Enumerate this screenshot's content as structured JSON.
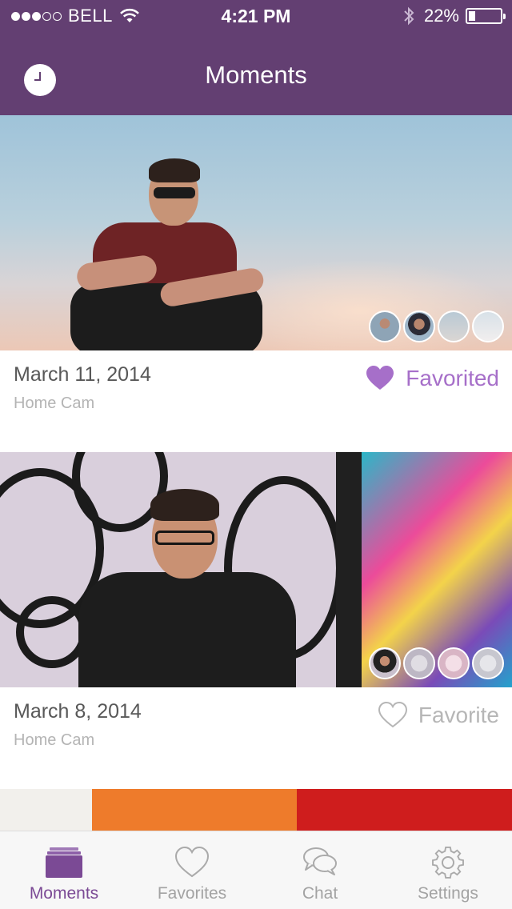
{
  "status_bar": {
    "carrier": "BELL",
    "time": "4:21 PM",
    "battery": "22%",
    "battery_level": 0.22,
    "signal_bars_filled": 3,
    "signal_bars_total": 5
  },
  "nav": {
    "title": "Moments",
    "left_icon": "clock-icon"
  },
  "moments": [
    {
      "date": "March 11, 2014",
      "source": "Home Cam",
      "favorite_label": "Favorited",
      "favorited": true,
      "thumbnail_count": 4
    },
    {
      "date": "March 8, 2014",
      "source": "Home Cam",
      "favorite_label": "Favorite",
      "favorited": false,
      "thumbnail_count": 4
    }
  ],
  "tabs": [
    {
      "label": "Moments",
      "icon": "moments-icon",
      "active": true
    },
    {
      "label": "Favorites",
      "icon": "heart-icon",
      "active": false
    },
    {
      "label": "Chat",
      "icon": "chat-icon",
      "active": false
    },
    {
      "label": "Settings",
      "icon": "gear-icon",
      "active": false
    }
  ],
  "colors": {
    "brand": "#633f72",
    "favorite_active": "#a66fc9",
    "tab_active": "#7b4a95",
    "inactive": "#b6b6b6"
  }
}
